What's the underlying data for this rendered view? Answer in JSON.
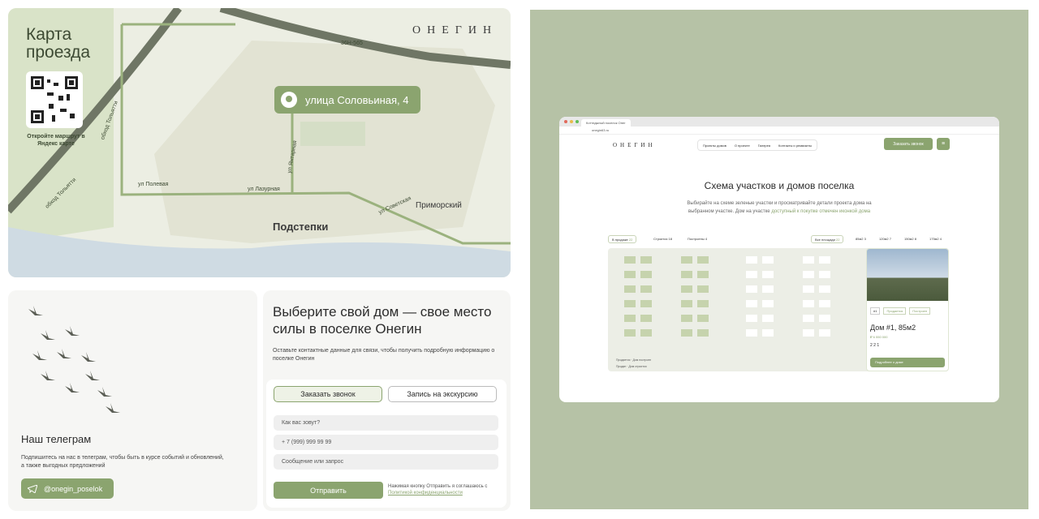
{
  "map": {
    "title_line1": "Карта",
    "title_line2": "проезда",
    "brand": "ОНЕГИН",
    "qr_caption": "Откройте маршрут в Яндекс карте",
    "address_pin": "улица Соловьиная, 4",
    "road_label": "36Н-565",
    "street_labels": [
      "обход Тольятти",
      "обход Тольятти",
      "ул Полевая",
      "ул Лазурная",
      "ул Янтарная",
      "ул Советская"
    ],
    "town_main": "Подстепки",
    "town_secondary": "Приморский"
  },
  "telegram": {
    "title": "Наш телеграм",
    "description": "Подпишитесь на нас в телеграм, чтобы быть в курсе событий и обновлений, а также выгодных предложений",
    "button_label": "@onegin_poselok"
  },
  "form": {
    "title": "Выберите свой дом — свое место силы в поселке Онегин",
    "description": "Оставьте контактные данные для связи, чтобы получить подробную информацию о поселке Онегин",
    "tab_call": "Заказать звонок",
    "tab_tour": "Запись на экскурсию",
    "name_placeholder": "Как вас зовут?",
    "phone_placeholder": "+ 7 (999) 999 99 99",
    "message_placeholder": "Сообщение или запрос",
    "submit_label": "Отправить",
    "agree_text": "Нажимая кнопку Отправить я соглашаюсь с",
    "agree_link": "Политикой конфиденциальности"
  },
  "browser": {
    "tab_title": "Коттеджный поселок Онег",
    "url": "onegin63.ru",
    "logo": "ОНЕГИН",
    "menu": [
      "Проекты домов",
      "О проекте",
      "Галерея",
      "Контакты и реквизиты"
    ],
    "call_button": "Заказать звонок",
    "scheme_title": "Схема участков  и домов поселка",
    "scheme_desc": "Выбирайте на схеме зеленые участки и просматривайте детали проекта дома на выбранном участке. Дом на участке",
    "scheme_desc_link": "доступный к покупке отмечен иконкой дома",
    "filters": [
      {
        "label": "В продаже",
        "count": "22"
      },
      {
        "label": "Строится",
        "count": "18"
      },
      {
        "label": "Построены",
        "count": "4"
      },
      {
        "label": "Все площади",
        "count": "22"
      },
      {
        "label": "85м2",
        "count": "3"
      },
      {
        "label": "120м2",
        "count": "7"
      },
      {
        "label": "150м2",
        "count": "8"
      },
      {
        "label": "175м2",
        "count": "4"
      }
    ],
    "legend": [
      "Продается",
      "Дом построен",
      "Продан",
      "Дом строится"
    ],
    "house": {
      "tags": [
        "#1",
        "Продается",
        "Построен"
      ],
      "title": "Дом #1, 85м2",
      "price": "₽ 6 550 000",
      "specs": "2  2  1",
      "button": "Подробнее о доме"
    }
  }
}
